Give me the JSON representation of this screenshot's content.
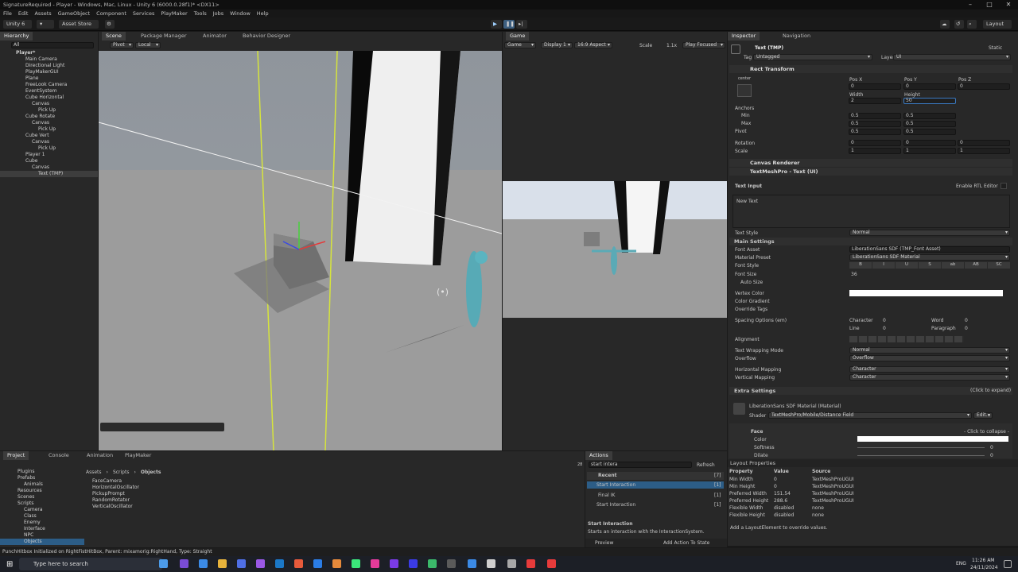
{
  "window": {
    "title": "SignatureRequired - Player - Windows, Mac, Linux - Unity 6 (6000.0.28f1)* <DX11>"
  },
  "menu": [
    "File",
    "Edit",
    "Assets",
    "GameObject",
    "Component",
    "Services",
    "PlayMaker",
    "Tools",
    "Jobs",
    "Window",
    "Help"
  ],
  "toolbar": {
    "account": "Unity 6",
    "asset_store": "Asset Store",
    "layout": "Layout"
  },
  "hierarchy": {
    "tab": "Hierarchy",
    "search_placeholder": "All",
    "items": [
      "Player*",
      "Main Camera",
      "Directional Light",
      "PlayMakerGUI",
      "Plane",
      "FreeLook Camera",
      "EventSystem",
      "Cube Horizontal",
      "Canvas",
      "Pick Up",
      "Cube Rotate",
      "Canvas",
      "Pick Up",
      "Cube Vert",
      "Canvas",
      "Pick Up",
      "Player 1",
      "Cube",
      "Canvas",
      "Text (TMP)"
    ]
  },
  "scene": {
    "tabs": [
      "Scene",
      "Package Manager",
      "Animator",
      "Behavior Designer"
    ],
    "pivot": "Pivot",
    "space": "Local",
    "persp": "< Persp"
  },
  "game": {
    "tab": "Game",
    "view": "Game",
    "display": "Display 1",
    "aspect": "16:9 Aspect",
    "scale_label": "Scale",
    "scale": "1.1x",
    "play_focused": "Play Focused"
  },
  "inspector": {
    "tabs": [
      "Inspector",
      "Navigation"
    ],
    "object_name": "Text (TMP)",
    "static": "Static",
    "tag_label": "Tag",
    "tag": "Untagged",
    "layer_label": "Layer",
    "layer": "UI",
    "rect_transform": "Rect Transform",
    "anchor_preset": "center",
    "pos_labels": [
      "Pos X",
      "Pos Y",
      "Pos Z"
    ],
    "pos_values": [
      "0",
      "0",
      "0"
    ],
    "size_labels": [
      "Width",
      "Height"
    ],
    "size_values": [
      "2",
      "50"
    ],
    "anchors_label": "Anchors",
    "min_label": "Min",
    "max_label": "Max",
    "pivot_label": "Pivot",
    "min": [
      "0.5",
      "0.5"
    ],
    "max": [
      "0.5",
      "0.5"
    ],
    "pivot": [
      "0.5",
      "0.5"
    ],
    "rotation_label": "Rotation",
    "rotation": [
      "0",
      "0",
      "0"
    ],
    "scale_label": "Scale",
    "scale": [
      "1",
      "1",
      "1"
    ],
    "canvas_renderer": "Canvas Renderer",
    "tmp_component": "TextMeshPro - Text (UI)",
    "text_input_label": "Text Input",
    "enable_rtl": "Enable RTL Editor",
    "text_value": "New Text",
    "text_style_label": "Text Style",
    "text_style": "Normal",
    "main_settings": "Main Settings",
    "font_asset_label": "Font Asset",
    "font_asset": "LiberationSans SDF (TMP_Font Asset)",
    "material_preset_label": "Material Preset",
    "material_preset": "LiberationSans SDF Material",
    "font_style_label": "Font Style",
    "font_style_buttons": [
      "B",
      "I",
      "U",
      "S",
      "ab",
      "AB",
      "SC"
    ],
    "font_size_label": "Font Size",
    "font_size": "36",
    "auto_size_label": "Auto Size",
    "vertex_color_label": "Vertex Color",
    "color_gradient_label": "Color Gradient",
    "override_tags_label": "Override Tags",
    "spacing_label": "Spacing Options (em)",
    "spacing": [
      {
        "label": "Character",
        "value": "0"
      },
      {
        "label": "Word",
        "value": "0"
      },
      {
        "label": "Line",
        "value": "0"
      },
      {
        "label": "Paragraph",
        "value": "0"
      }
    ],
    "alignment_label": "Alignment",
    "wrapping_label": "Text Wrapping Mode",
    "wrapping": "Normal",
    "overflow_label": "Overflow",
    "overflow": "Overflow",
    "hmap_label": "Horizontal Mapping",
    "hmap": "Character",
    "vmap_label": "Vertical Mapping",
    "vmap": "Character",
    "extra_settings": "Extra Settings",
    "click_expand": "(Click to expand)",
    "material_name": "LiberationSans SDF Material (Material)",
    "shader_label": "Shader",
    "shader": "TextMeshPro/Mobile/Distance Field",
    "edit": "Edit...",
    "face_label": "Face",
    "click_collapse": "- Click to collapse -",
    "face_rows": [
      "Color",
      "Softness",
      "Dilate"
    ],
    "softness": "0",
    "dilate": "0",
    "layout_props": "Layout Properties",
    "layout_headers": [
      "Property",
      "Value",
      "Source"
    ],
    "layout_rows": [
      [
        "Min Width",
        "0",
        "TextMeshProUGUI"
      ],
      [
        "Min Height",
        "0",
        "TextMeshProUGUI"
      ],
      [
        "Preferred Width",
        "151.54",
        "TextMeshProUGUI"
      ],
      [
        "Preferred Height",
        "288.6",
        "TextMeshProUGUI"
      ],
      [
        "Flexible Width",
        "disabled",
        "none"
      ],
      [
        "Flexible Height",
        "disabled",
        "none"
      ]
    ],
    "add_layout": "Add a LayoutElement to override values."
  },
  "project": {
    "tabs": [
      "Project",
      "Console",
      "Animation",
      "PlayMaker"
    ],
    "folders": [
      "Plugins",
      "Prefabs",
      "Animals",
      "Resources",
      "Scenes",
      "Scripts",
      "Camera",
      "Class",
      "Enemy",
      "Interface",
      "NPC",
      "Objects"
    ],
    "breadcrumb": [
      "Assets",
      "Scripts",
      "Objects"
    ],
    "files": [
      "FaceCamera",
      "HorizontalOscillator",
      "PickupPrompt",
      "RandomRotator",
      "VerticalOscillator"
    ],
    "count": "28"
  },
  "actions": {
    "tab": "Actions",
    "search": "start intera",
    "refresh": "Refresh",
    "recent": "Recent",
    "recent_count": "[7]",
    "list": [
      {
        "name": "Start Interaction",
        "count": "[1]"
      },
      {
        "name": "Final IK",
        "count": "[1]"
      },
      {
        "name": "Start Interaction",
        "count": "[1]"
      }
    ],
    "detail_title": "Start Interaction",
    "detail_desc": "Starts an interaction with the InteractionSystem.",
    "preview": "Preview",
    "add_action": "Add Action To State"
  },
  "status": "PunchHitbox Initialized on RightFistHitBox, Parent: mixamorig:RightHand, Type: Straight",
  "taskbar": {
    "search_placeholder": "Type here to search",
    "time": "11:26 AM",
    "date": "24/11/2024",
    "lang": "ENG"
  },
  "colors": {
    "accent": "#2c5d87",
    "selected": "#2c5d87",
    "bg": "#282828",
    "dark": "#191919"
  }
}
